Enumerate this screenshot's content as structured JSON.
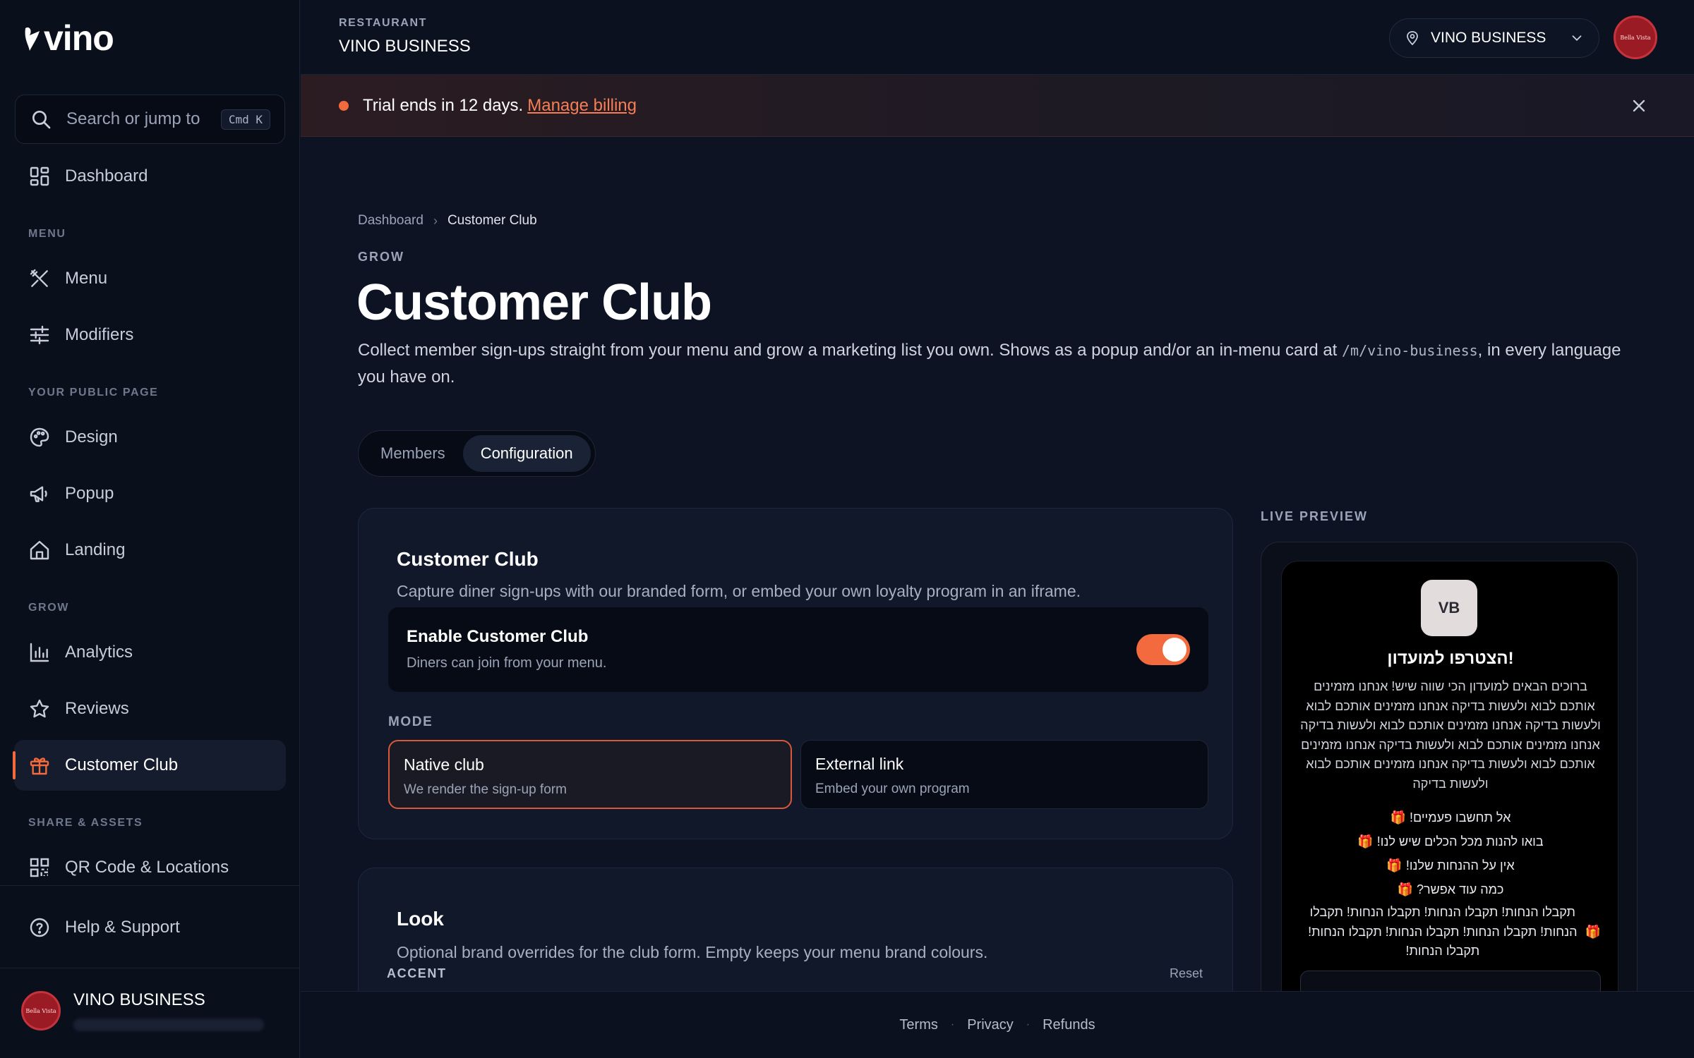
{
  "brand": {
    "logo_text": "vino"
  },
  "sidebar": {
    "search": {
      "placeholder": "Search or jump to",
      "shortcut": "Cmd K"
    },
    "dashboard": {
      "label": "Dashboard",
      "icon": "dashboard-icon"
    },
    "sections": {
      "menu": "MENU",
      "public_page": "YOUR PUBLIC PAGE",
      "grow": "GROW",
      "share": "SHARE & ASSETS"
    },
    "items": {
      "menu": {
        "label": "Menu",
        "icon": "utensils-icon"
      },
      "modifiers": {
        "label": "Modifiers",
        "icon": "sliders-icon"
      },
      "design": {
        "label": "Design",
        "icon": "palette-icon"
      },
      "popup": {
        "label": "Popup",
        "icon": "megaphone-icon"
      },
      "landing": {
        "label": "Landing",
        "icon": "home-icon"
      },
      "analytics": {
        "label": "Analytics",
        "icon": "bar-chart-icon"
      },
      "reviews": {
        "label": "Reviews",
        "icon": "star-icon"
      },
      "customer_club": {
        "label": "Customer Club",
        "icon": "gift-icon",
        "active": true
      },
      "qr": {
        "label": "QR Code & Locations",
        "icon": "qr-code-icon"
      },
      "help": {
        "label": "Help & Support",
        "icon": "help-circle-icon"
      }
    },
    "account": {
      "name": "VINO BUSINESS"
    }
  },
  "header": {
    "restaurant_label": "RESTAURANT",
    "restaurant_name": "VINO BUSINESS",
    "location_select": "VINO BUSINESS"
  },
  "banner": {
    "text": "Trial ends in 12 days.",
    "link": "Manage billing"
  },
  "breadcrumb": {
    "parent": "Dashboard",
    "current": "Customer Club"
  },
  "page": {
    "eyebrow": "GROW",
    "title": "Customer Club",
    "description_before": "Collect member sign-ups straight from your menu and grow a marketing list you own. Shows as a popup and/or an in-menu card at ",
    "description_code": "/m/vino-business",
    "description_after": ", in every language you have on."
  },
  "tabs": [
    {
      "label": "Members",
      "active": false
    },
    {
      "label": "Configuration",
      "active": true
    }
  ],
  "club_card": {
    "title": "Customer Club",
    "subtitle": "Capture diner sign-ups with our branded form, or embed your own loyalty program in an iframe.",
    "toggle_title": "Enable Customer Club",
    "toggle_subtitle": "Diners can join from your menu.",
    "enabled": true,
    "mode_label": "MODE",
    "modes": [
      {
        "title": "Native club",
        "subtitle": "We render the sign-up form",
        "selected": true
      },
      {
        "title": "External link",
        "subtitle": "Embed your own program",
        "selected": false
      }
    ]
  },
  "look_card": {
    "title": "Look",
    "subtitle": "Optional brand overrides for the club form. Empty keeps your menu brand colours.",
    "accent_label": "ACCENT",
    "reset_label": "Reset"
  },
  "preview": {
    "label": "LIVE PREVIEW",
    "logo_initials": "VB",
    "title": "הצטרפו למועדון!",
    "body": "ברוכים הבאים למועדון הכי שווה שיש! אנחנו מזמינים אותכם לבוא ולעשות בדיקה אנחנו מזמינים אותכם לבוא ולעשות בדיקה אנחנו מזמינים אותכם לבוא ולעשות בדיקה אנחנו מזמינים אותכם לבוא ולעשות בדיקה אנחנו מזמינים אותכם לבוא ולעשות בדיקה אנחנו מזמינים אותכם לבוא ולעשות בדיקה",
    "perks": [
      "אל תחשבו פעמיים!",
      "בואו להנות מכל הכלים שיש לנו!",
      "אין על ההנחות שלנו!",
      "כמה עוד אפשר?"
    ],
    "perk_long": "תקבלו הנחות! תקבלו הנחות! תקבלו הנחות! תקבלו הנחות! תקבלו הנחות! תקבלו הנחות! תקבלו הנחות! תקבלו הנחות!",
    "gift_glyph": "🎁"
  },
  "footer": {
    "terms": "Terms",
    "privacy": "Privacy",
    "refunds": "Refunds"
  },
  "colors": {
    "accent": "#f26a3d",
    "background": "#0d1322",
    "sidebar": "#0a0f1c"
  }
}
